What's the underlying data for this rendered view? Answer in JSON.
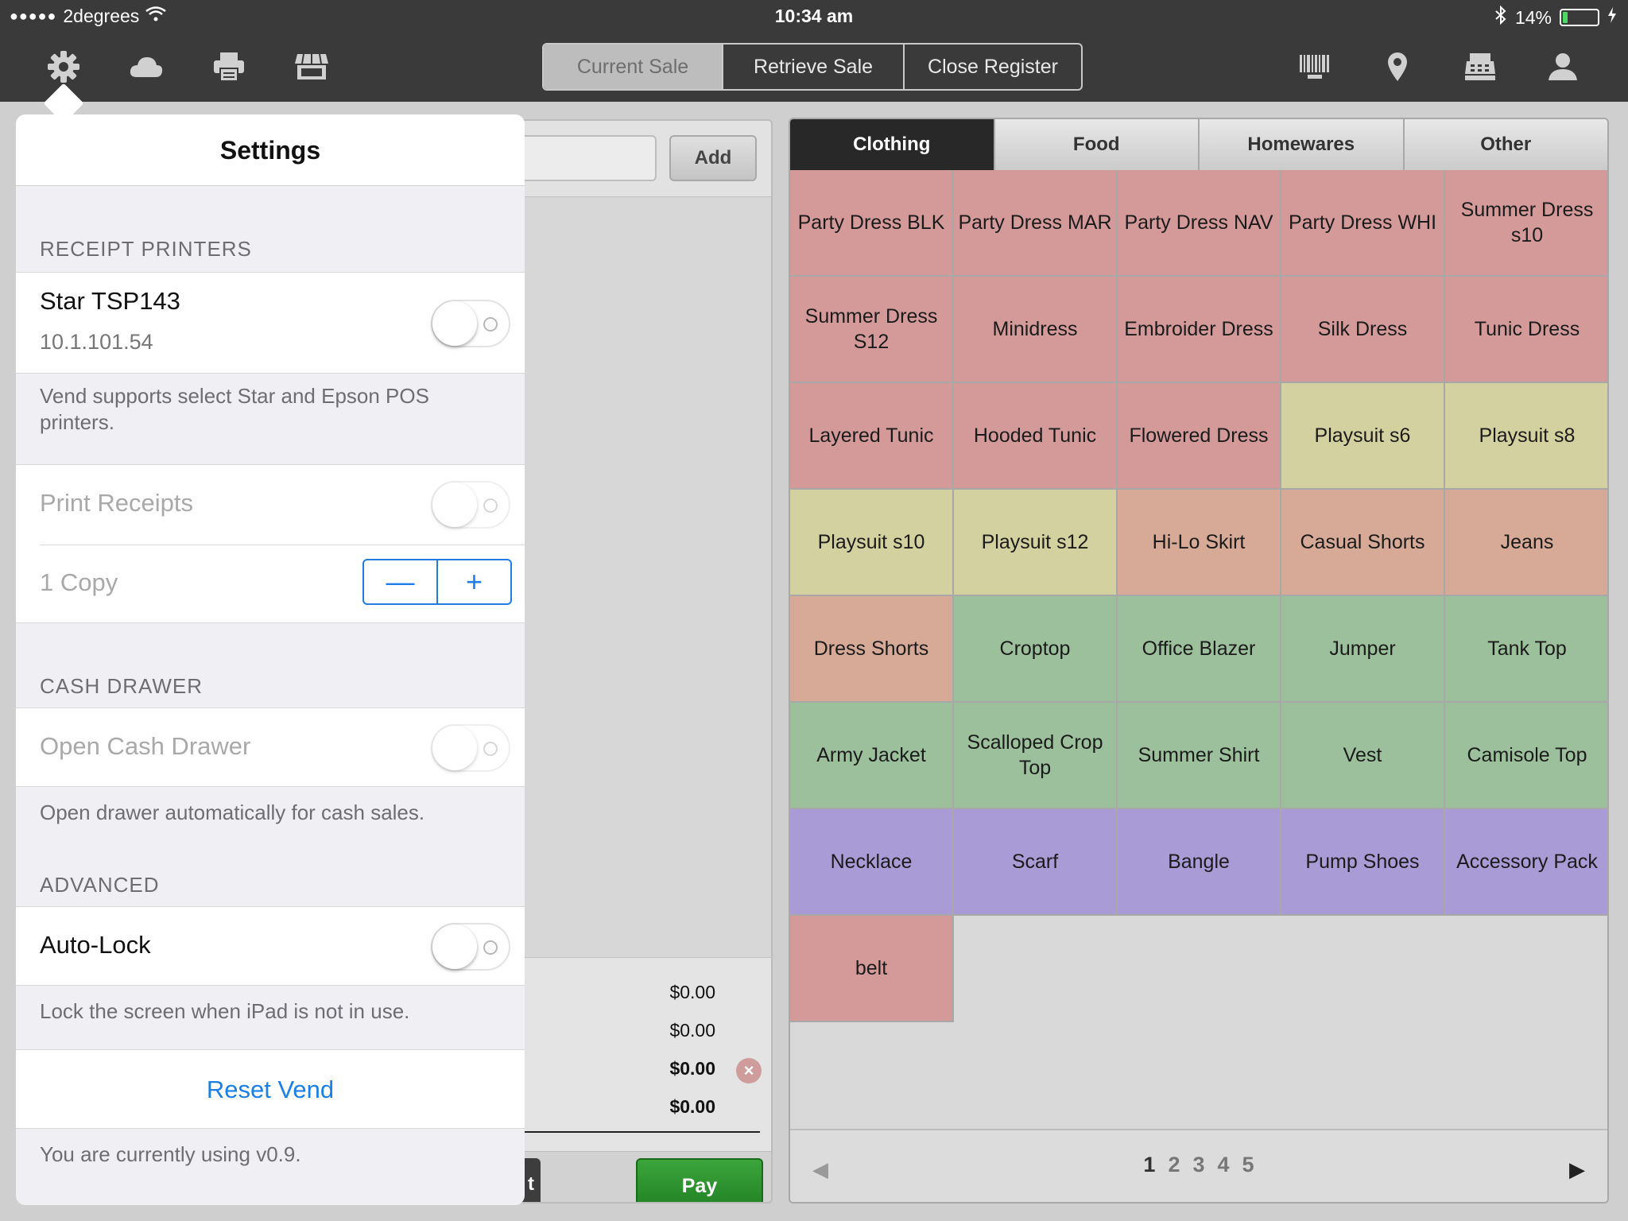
{
  "status_bar": {
    "carrier": "2degrees",
    "signal": "●●●●●",
    "time": "10:34 am",
    "battery_percent": "14%",
    "battery_level": 0.14
  },
  "toolbar": {
    "icons": [
      "gear-icon",
      "cloud-icon",
      "printer-icon",
      "store-icon",
      "barcode-icon",
      "location-pin-icon",
      "register-icon",
      "user-icon"
    ],
    "segments": [
      "Current Sale",
      "Retrieve Sale",
      "Close Register"
    ],
    "active_segment": "Current Sale"
  },
  "sale": {
    "add_label": "Add",
    "totals": [
      "$0.00",
      "$0.00",
      "$0.00",
      "$0.00"
    ],
    "park_label": "t",
    "pay_label": "Pay"
  },
  "catalog": {
    "tabs": [
      "Clothing",
      "Food",
      "Homewares",
      "Other"
    ],
    "active_tab": "Clothing",
    "colors": {
      "pink": "#d49a9a",
      "yellow": "#d4d1a0",
      "tan": "#d6aa96",
      "green": "#9cbf9c",
      "purple": "#a99bd6"
    },
    "products": [
      {
        "label": "Party Dress BLK",
        "color": "pink"
      },
      {
        "label": "Party Dress MAR",
        "color": "pink"
      },
      {
        "label": "Party Dress NAV",
        "color": "pink"
      },
      {
        "label": "Party Dress WHI",
        "color": "pink"
      },
      {
        "label": "Summer Dress s10",
        "color": "pink"
      },
      {
        "label": "Summer Dress S12",
        "color": "pink"
      },
      {
        "label": "Minidress",
        "color": "pink"
      },
      {
        "label": "Embroider Dress",
        "color": "pink"
      },
      {
        "label": "Silk Dress",
        "color": "pink"
      },
      {
        "label": "Tunic Dress",
        "color": "pink"
      },
      {
        "label": "Layered Tunic",
        "color": "pink"
      },
      {
        "label": "Hooded Tunic",
        "color": "pink"
      },
      {
        "label": "Flowered Dress",
        "color": "pink"
      },
      {
        "label": "Playsuit s6",
        "color": "yellow"
      },
      {
        "label": "Playsuit s8",
        "color": "yellow"
      },
      {
        "label": "Playsuit s10",
        "color": "yellow"
      },
      {
        "label": "Playsuit s12",
        "color": "yellow"
      },
      {
        "label": "Hi-Lo Skirt",
        "color": "tan"
      },
      {
        "label": "Casual Shorts",
        "color": "tan"
      },
      {
        "label": "Jeans",
        "color": "tan"
      },
      {
        "label": "Dress Shorts",
        "color": "tan"
      },
      {
        "label": "Croptop",
        "color": "green"
      },
      {
        "label": "Office Blazer",
        "color": "green"
      },
      {
        "label": "Jumper",
        "color": "green"
      },
      {
        "label": "Tank Top",
        "color": "green"
      },
      {
        "label": "Army Jacket",
        "color": "green"
      },
      {
        "label": "Scalloped Crop Top",
        "color": "green"
      },
      {
        "label": "Summer Shirt",
        "color": "green"
      },
      {
        "label": "Vest",
        "color": "green"
      },
      {
        "label": "Camisole Top",
        "color": "green"
      },
      {
        "label": "Necklace",
        "color": "purple"
      },
      {
        "label": "Scarf",
        "color": "purple"
      },
      {
        "label": "Bangle",
        "color": "purple"
      },
      {
        "label": "Pump Shoes",
        "color": "purple"
      },
      {
        "label": "Accessory Pack",
        "color": "purple"
      },
      {
        "label": "belt",
        "color": "pink"
      }
    ],
    "pages": [
      "1",
      "2",
      "3",
      "4",
      "5"
    ],
    "current_page": "1",
    "prev_arrow": "◀",
    "next_arrow": "▶"
  },
  "settings": {
    "title": "Settings",
    "receipt_printers": {
      "header": "RECEIPT PRINTERS",
      "printer_name": "Star TSP143",
      "printer_ip": "10.1.101.54",
      "printer_enabled": false,
      "note": "Vend supports select Star and Epson POS printers.",
      "print_receipts_label": "Print Receipts",
      "print_receipts_enabled": false,
      "copies_label": "1 Copy",
      "minus": "—",
      "plus": "+"
    },
    "cash_drawer": {
      "header": "CASH DRAWER",
      "open_label": "Open Cash Drawer",
      "open_enabled": false,
      "note": "Open drawer automatically for cash sales."
    },
    "advanced": {
      "header": "ADVANCED",
      "autolock_label": "Auto-Lock",
      "autolock_enabled": false,
      "note": "Lock the screen when iPad is not in use."
    },
    "reset_label": "Reset Vend",
    "version_note": "You are currently using v0.9."
  }
}
